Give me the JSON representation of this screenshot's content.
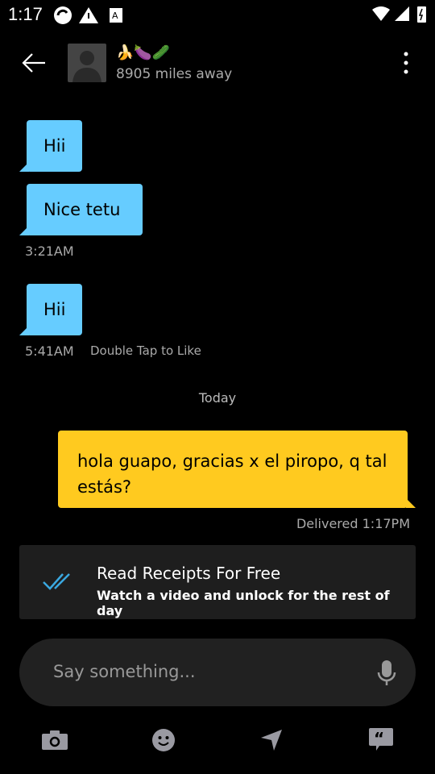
{
  "status": {
    "time": "1:17"
  },
  "header": {
    "name": "🍌🍆🥒",
    "distance": "8905 miles away"
  },
  "messages": [
    {
      "text": "Hii",
      "from": "them"
    },
    {
      "text": "Nice tetu",
      "from": "them",
      "time": "3:21AM"
    },
    {
      "text": "Hii",
      "from": "them",
      "time": "5:41AM",
      "hint": "Double Tap to Like"
    }
  ],
  "divider": "Today",
  "my_message": {
    "text": "hola guapo, gracias x el piropo, q tal estás?",
    "status": "Delivered 1:17PM"
  },
  "promo": {
    "title": "Read Receipts For Free",
    "subtitle": "Watch a video and unlock for the rest of day"
  },
  "composer": {
    "placeholder": "Say something..."
  },
  "colors": {
    "them_bubble": "#66ccff",
    "my_bubble": "#ffca1f",
    "icon": "#9a9aa2"
  }
}
